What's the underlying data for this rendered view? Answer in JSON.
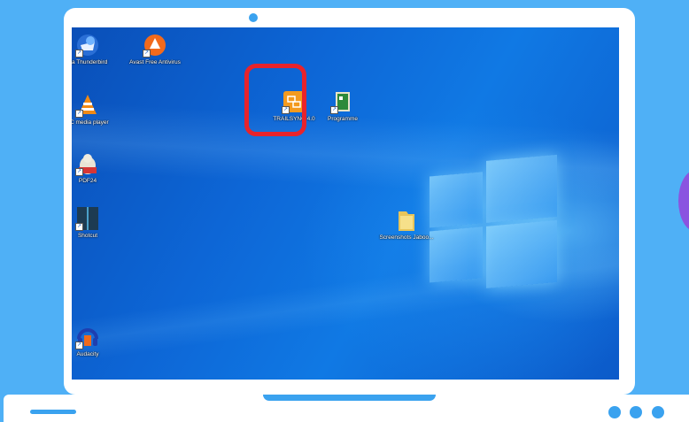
{
  "desktop": {
    "icons": [
      {
        "label": "illa Thunderbird",
        "icon": "thunderbird-icon"
      },
      {
        "label": "Avast Free Antivirus",
        "icon": "avast-icon"
      },
      {
        "label": "LC media player",
        "icon": "vlc-icon"
      },
      {
        "label": "PDF24",
        "icon": "pdf24-icon"
      },
      {
        "label": "Shotcut",
        "icon": "shotcut-icon"
      },
      {
        "label": "Audacity",
        "icon": "audacity-icon"
      },
      {
        "label": "TRAILSYNC 4.0",
        "icon": "trailsync-icon"
      },
      {
        "label": "Programme",
        "icon": "programme-icon"
      },
      {
        "label": "Screenshots Jaboo...",
        "icon": "folder-icon"
      }
    ]
  },
  "colors": {
    "background": "#4fb0f6",
    "accent": "#3aa2ef",
    "highlight": "#e8232b",
    "blob": "#8a54e0"
  }
}
